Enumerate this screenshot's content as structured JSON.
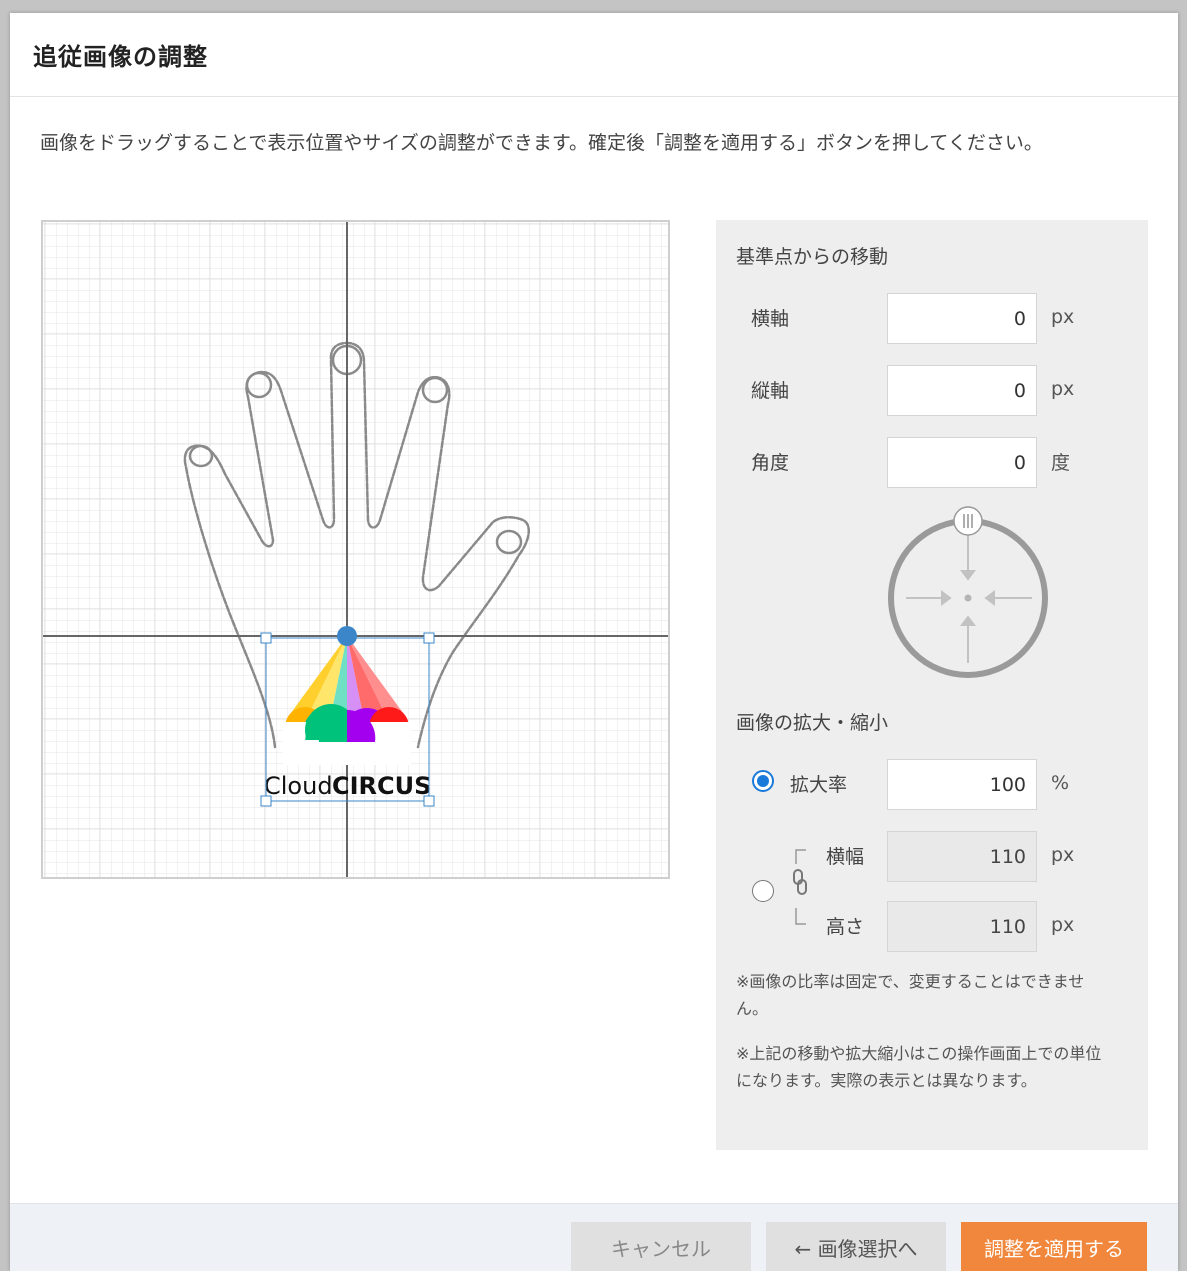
{
  "dialog": {
    "title": "追従画像の調整",
    "instruction": "画像をドラッグすることで表示位置やサイズの調整ができます。確定後「調整を適用する」ボタンを押してください。"
  },
  "canvas": {
    "logo_text_light": "Cloud",
    "logo_text_bold": "CIRCUS"
  },
  "panel": {
    "move_title": "基準点からの移動",
    "x_label": "横軸",
    "x_value": "0",
    "x_unit": "px",
    "y_label": "縦軸",
    "y_value": "0",
    "y_unit": "px",
    "angle_label": "角度",
    "angle_value": "0",
    "angle_unit": "度",
    "scale_title": "画像の拡大・縮小",
    "ratio_label": "拡大率",
    "ratio_value": "100",
    "ratio_unit": "%",
    "width_label": "横幅",
    "width_value": "110",
    "width_unit": "px",
    "height_label": "高さ",
    "height_value": "110",
    "height_unit": "px",
    "scale_mode_selected": "ratio",
    "note1": "※画像の比率は固定で、変更することはできません。",
    "note2": "※上記の移動や拡大縮小はこの操作画面上での単位になります。実際の表示とは異なります。"
  },
  "footer": {
    "cancel_label": "キャンセル",
    "back_label": "画像選択へ",
    "apply_label": "調整を適用する"
  },
  "colors": {
    "apply_button": "#f0873c",
    "accent_blue": "#1a7ad9",
    "handle_blue": "#3a86c8"
  }
}
